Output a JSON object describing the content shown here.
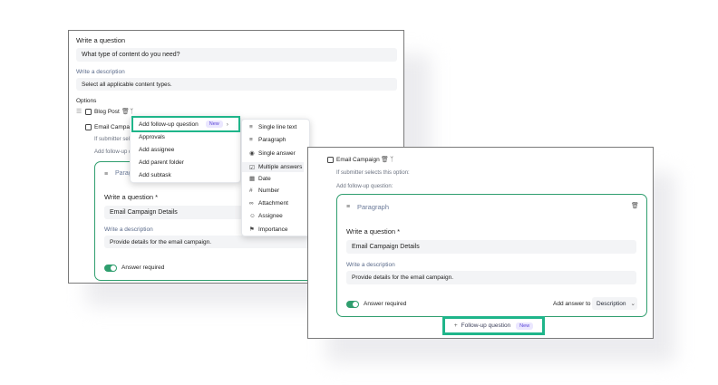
{
  "colors": {
    "accent_green": "#1fb58a",
    "toggle_green": "#2f9e6e",
    "badge_bg": "#ebe7ff",
    "badge_text": "#5b45d6"
  },
  "panel_a": {
    "question_label": "Write a question",
    "question_value": "What type of content do you need?",
    "description_label": "Write a description",
    "description_value": "Select all applicable content types.",
    "options_label": "Options",
    "option_1": "Blog Post",
    "option_2": "Email Campaign",
    "if_submitter": "If submitter selects",
    "add_follow_up": "Add follow-up q",
    "card_type": "Parag",
    "card_question_label": "Write a question *",
    "card_question_value": "Email Campaign Details",
    "card_description_label": "Write a description",
    "card_description_value": "Provide details for the email campaign.",
    "answer_required": "Answer required"
  },
  "menu_main": {
    "items": [
      "Add follow-up question",
      "Approvals",
      "Add assignee",
      "Add parent folder",
      "Add subtask"
    ],
    "badge": "New"
  },
  "menu_types": {
    "items": [
      {
        "label": "Single line text",
        "icon": "text-lines-icon"
      },
      {
        "label": "Paragraph",
        "icon": "paragraph-icon"
      },
      {
        "label": "Single answer",
        "icon": "radio-check-icon"
      },
      {
        "label": "Multiple answers",
        "icon": "checkbox-icon"
      },
      {
        "label": "Date",
        "icon": "calendar-icon"
      },
      {
        "label": "Number",
        "icon": "hash-icon"
      },
      {
        "label": "Attachment",
        "icon": "paperclip-icon"
      },
      {
        "label": "Assignee",
        "icon": "person-icon"
      },
      {
        "label": "Importance",
        "icon": "flag-icon"
      }
    ]
  },
  "panel_b": {
    "option_label": "Email Campaign",
    "if_submitter": "If submitter selects this option:",
    "add_follow_up": "Add follow-up question:",
    "card_type": "Paragraph",
    "card_question_label": "Write a question *",
    "card_question_value": "Email Campaign Details",
    "card_description_label": "Write a description",
    "card_description_value": "Provide details for the email campaign.",
    "answer_required": "Answer required",
    "add_answer_to": "Add answer to",
    "add_answer_select": "Description",
    "follow_up_button": "Follow-up question",
    "follow_up_badge": "New"
  }
}
